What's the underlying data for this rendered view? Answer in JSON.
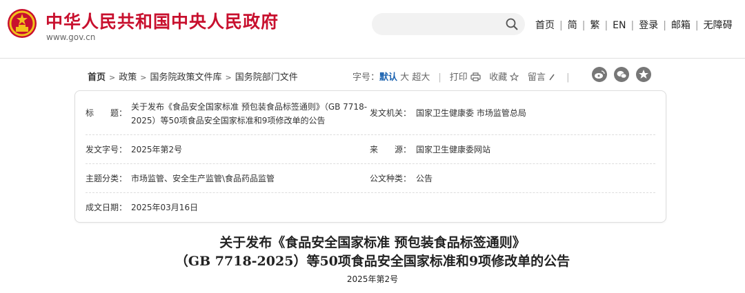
{
  "header": {
    "site_title": "中华人民共和国中央人民政府",
    "site_url": "www.gov.cn",
    "nav": [
      "首页",
      "简",
      "繁",
      "EN",
      "登录",
      "邮箱",
      "无障碍"
    ]
  },
  "breadcrumb": {
    "home": "首页",
    "items": [
      "政策",
      "国务院政策文件库",
      "国务院部门文件"
    ]
  },
  "tools": {
    "font_label": "字号：",
    "font_default": "默认",
    "font_large": "大",
    "font_xlarge": "超大",
    "print": "打印",
    "favorite": "收藏",
    "comment": "留言"
  },
  "metadata": {
    "title_label": "标　　题：",
    "title_value": "关于发布《食品安全国家标准 预包装食品标签通则》（GB 7718-2025）等50项食品安全国家标准和9项修改单的公告",
    "issuer_label": "发文机关：",
    "issuer_value": "国家卫生健康委 市场监管总局",
    "doc_no_label": "发文字号：",
    "doc_no_value": "2025年第2号",
    "source_label": "来　　源：",
    "source_value": "国家卫生健康委网站",
    "category_label": "主题分类：",
    "category_value": "市场监管、安全生产监管\\食品药品监管",
    "type_label": "公文种类：",
    "type_value": "公告",
    "date_label": "成文日期：",
    "date_value": "2025年03月16日"
  },
  "document": {
    "title_line1": "关于发布《食品安全国家标准 预包装食品标签通则》",
    "title_line2": "（GB 7718-2025）等50项食品安全国家标准和9项修改单的公告",
    "number": "2025年第2号"
  },
  "colors": {
    "brand_red": "#c8102e",
    "emblem_gold": "#f2c11b",
    "active_blue": "#1a62b0"
  },
  "icons": [
    "national-emblem-icon",
    "search-icon",
    "print-icon",
    "star-icon",
    "pencil-icon",
    "weibo-icon",
    "wechat-icon",
    "favorite-circle-icon"
  ]
}
